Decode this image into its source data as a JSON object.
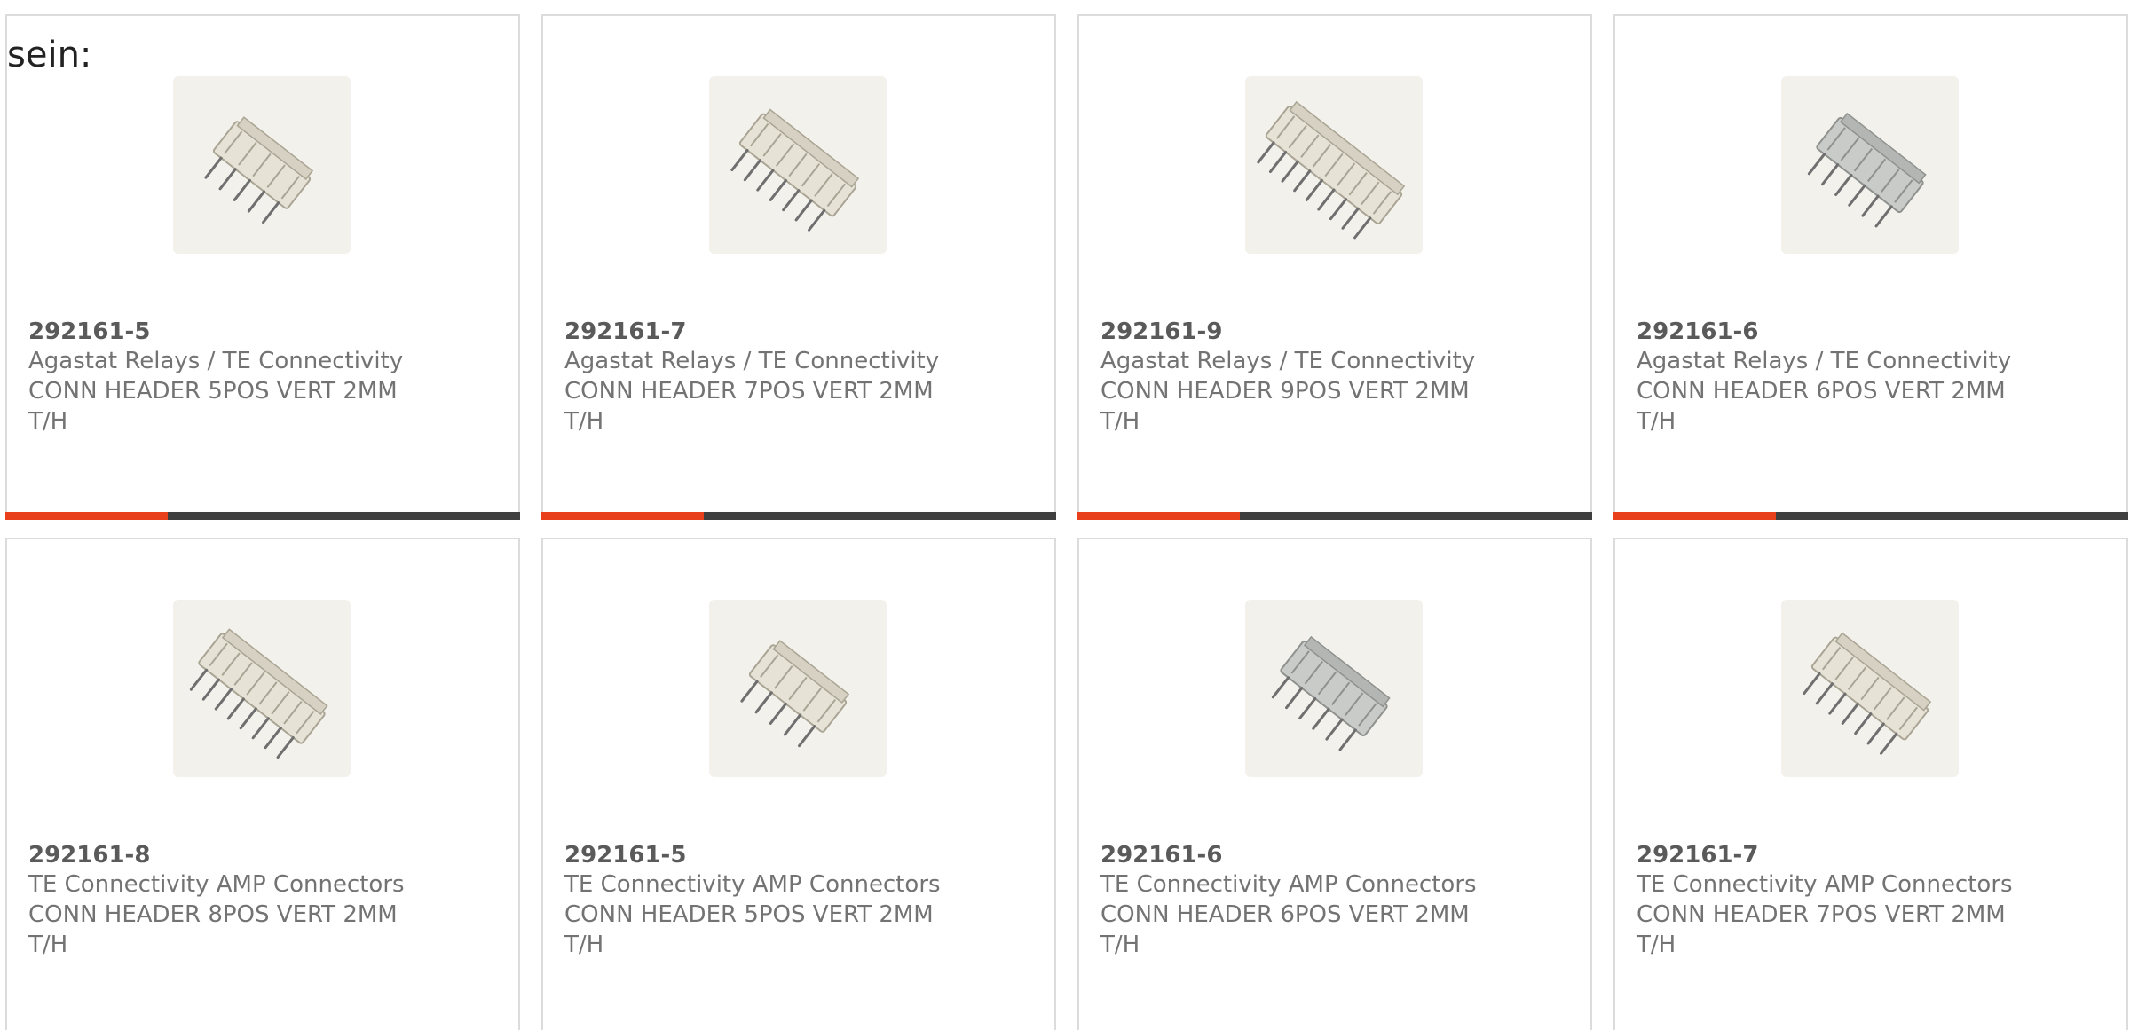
{
  "intro_text": "sein:",
  "colors": {
    "accent": "#e8401c",
    "bar": "#3f3f3f",
    "border": "#dcdcdc",
    "text": "#737373"
  },
  "products": [
    {
      "part_number": "292161-5",
      "manufacturer": "Agastat Relays / TE Connectivity",
      "description": "CONN HEADER 5POS VERT 2MM T/H",
      "image_icon": "connector-header-icon"
    },
    {
      "part_number": "292161-7",
      "manufacturer": "Agastat Relays / TE Connectivity",
      "description": "CONN HEADER 7POS VERT 2MM T/H",
      "image_icon": "connector-header-icon"
    },
    {
      "part_number": "292161-9",
      "manufacturer": "Agastat Relays / TE Connectivity",
      "description": "CONN HEADER 9POS VERT 2MM T/H",
      "image_icon": "connector-header-icon"
    },
    {
      "part_number": "292161-6",
      "manufacturer": "Agastat Relays / TE Connectivity",
      "description": "CONN HEADER 6POS VERT 2MM T/H",
      "image_icon": "connector-header-icon"
    },
    {
      "part_number": "292161-8",
      "manufacturer": "TE Connectivity AMP Connectors",
      "description": "CONN HEADER 8POS VERT 2MM T/H",
      "image_icon": "connector-header-icon"
    },
    {
      "part_number": "292161-5",
      "manufacturer": "TE Connectivity AMP Connectors",
      "description": "CONN HEADER 5POS VERT 2MM T/H",
      "image_icon": "connector-header-icon"
    },
    {
      "part_number": "292161-6",
      "manufacturer": "TE Connectivity AMP Connectors",
      "description": "CONN HEADER 6POS VERT 2MM T/H",
      "image_icon": "connector-header-icon"
    },
    {
      "part_number": "292161-7",
      "manufacturer": "TE Connectivity AMP Connectors",
      "description": "CONN HEADER 7POS VERT 2MM T/H",
      "image_icon": "connector-header-icon"
    }
  ]
}
